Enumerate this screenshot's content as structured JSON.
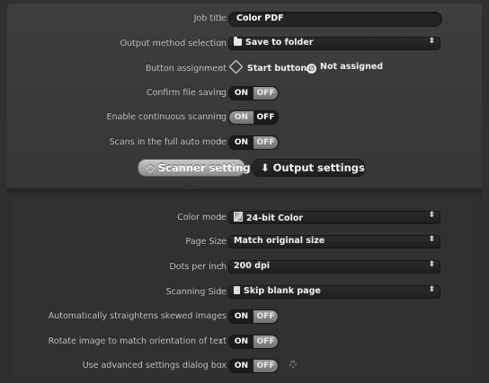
{
  "top": {
    "job_title": {
      "label": "Job title",
      "value": "Color PDF"
    },
    "output_method": {
      "label": "Output method selection",
      "value": "Save to folder",
      "icon": "folder-icon"
    },
    "button_assignment": {
      "label": "Button assignment",
      "options": [
        "Start button",
        "Not assigned"
      ],
      "selected": "Start button"
    },
    "confirm_file_saving": {
      "label": "Confirm file saving",
      "state": "OFF"
    },
    "continuous_scanning": {
      "label": "Enable continuous scanning",
      "state": "ON"
    },
    "full_auto_mode": {
      "label": "Scans in the full auto mode",
      "state": "OFF"
    }
  },
  "toggle": {
    "on": "ON",
    "off": "OFF"
  },
  "colon": ":",
  "tabs": {
    "scanner": "Scanner setting",
    "output": "Output settings",
    "active": "scanner"
  },
  "scanner": {
    "color_mode": {
      "label": "Color mode",
      "value": "24-bit Color",
      "icon": "color-mode-icon"
    },
    "page_size": {
      "label": "Page Size",
      "value": "Match original size"
    },
    "dpi": {
      "label": "Dots per inch",
      "value": "200 dpi"
    },
    "scanning_side": {
      "label": "Scanning Side",
      "value": "Skip blank page",
      "icon": "page-icon"
    },
    "straighten": {
      "label": "Automatically straightens skewed images",
      "state": "OFF"
    },
    "rotate": {
      "label": "Rotate image to match orientation of text",
      "state": "OFF"
    },
    "advanced": {
      "label": "Use advanced settings dialog box",
      "state": "OFF",
      "icon": "gear-icon"
    }
  },
  "colors": {
    "background": "#303030",
    "tab_active": "#a8a8a8",
    "toggle_selected": "#858585"
  }
}
